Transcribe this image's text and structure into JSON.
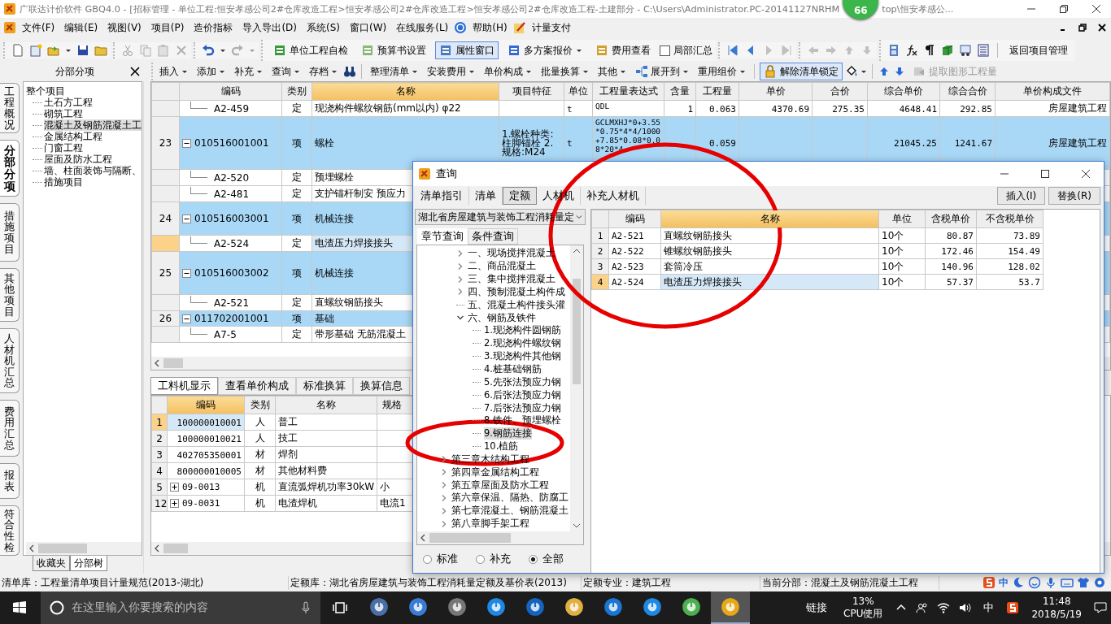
{
  "title_bar": {
    "title": "广联达计价软件 GBQ4.0 - [招标管理 - 单位工程:恒安孝感公司2#仓库改造工程>恒安孝感公司2#仓库改造工程>恒安孝感公司2#仓库改造工程-土建部分 - C:\\Users\\Administrator.PC-20141127NRHM",
    "title_tail": "top\\恒安孝感公..."
  },
  "floating_badge": "66",
  "menu": [
    "文件(F)",
    "编辑(E)",
    "视图(V)",
    "项目(P)",
    "造价指标",
    "导入导出(D)",
    "系统(S)",
    "窗口(W)",
    "在线服务(L)",
    "帮助(H)",
    "计量支付"
  ],
  "toolbar": {
    "buttons": [
      {
        "label": "单位工程自检",
        "pressed": false
      },
      {
        "label": "预算书设置",
        "pressed": false
      },
      {
        "label": "属性窗口",
        "pressed": true
      },
      {
        "label": "多方案报价",
        "pressed": false
      },
      {
        "label": "费用查看",
        "pressed": false
      }
    ],
    "checkbox": {
      "label": "局部汇总",
      "checked": false
    },
    "return_button": "返回项目管理"
  },
  "panel_header": "分部分项",
  "toolbar2": {
    "group1": [
      "插入",
      "添加",
      "补充",
      "查询",
      "存档"
    ],
    "group2": [
      "整理清单",
      "安装费用",
      "单价构成",
      "批量换算",
      "其他",
      "展开到",
      "重用组价"
    ],
    "unlock": {
      "label": "解除清单锁定",
      "pressed": true
    },
    "extract": {
      "label": "提取图形工程量",
      "disabled": true
    }
  },
  "side_tabs": [
    {
      "label": "工程概况",
      "selected": false
    },
    {
      "label": "分部分项",
      "selected": true
    },
    {
      "label": "措施项目",
      "selected": false
    },
    {
      "label": "其他项目",
      "selected": false
    },
    {
      "label": "人材机汇总",
      "selected": false
    },
    {
      "label": "费用汇总",
      "selected": false
    },
    {
      "label": "报表",
      "selected": false
    },
    {
      "label": "符合性检",
      "selected": false
    }
  ],
  "tree": {
    "label": "整个项目",
    "children": [
      {
        "label": "土石方工程",
        "selected": false
      },
      {
        "label": "砌筑工程",
        "selected": false
      },
      {
        "label": "混凝土及钢筋混凝土工",
        "selected": true
      },
      {
        "label": "金属结构工程",
        "selected": false
      },
      {
        "label": "门窗工程",
        "selected": false
      },
      {
        "label": "屋面及防水工程",
        "selected": false
      },
      {
        "label": "墙、柱面装饰与隔断、",
        "selected": false
      },
      {
        "label": "措施项目",
        "selected": false
      }
    ]
  },
  "tree_tabs": [
    {
      "label": "收藏夹",
      "selected": false
    },
    {
      "label": "分部树",
      "selected": true
    }
  ],
  "grid": {
    "columns": [
      {
        "label": "编码",
        "selected": false
      },
      {
        "label": "类别",
        "selected": false
      },
      {
        "label": "名称",
        "selected": true
      },
      {
        "label": "项目特征",
        "selected": false
      },
      {
        "label": "单位",
        "selected": false
      },
      {
        "label": "工程量表达式",
        "selected": false
      },
      {
        "label": "含量",
        "selected": false
      },
      {
        "label": "工程量",
        "selected": false
      },
      {
        "label": "单价",
        "selected": false
      },
      {
        "label": "合价",
        "selected": false
      },
      {
        "label": "综合单价",
        "selected": false
      },
      {
        "label": "综合合价",
        "selected": false
      },
      {
        "label": "单价构成文件",
        "selected": false
      }
    ],
    "rows": [
      {
        "kind": "sub",
        "code": "A2-459",
        "type": "定",
        "name": "现浇构件螺纹钢筋(mm以内) φ22",
        "unit": "t",
        "expr": "QDL",
        "content": "1",
        "qty": "0.063",
        "price": "4370.69",
        "total": "275.35",
        "comp_price": "4648.41",
        "comp_total": "292.85",
        "file": "房屋建筑工程",
        "selected": false
      },
      {
        "kind": "item",
        "no": "23",
        "expanded": true,
        "code": "010516001001",
        "type": "项",
        "name": "螺栓",
        "feature": "1.螺栓种类:柱脚锚栓 2.规格:M24",
        "unit": "t",
        "expr": "GCLMXHJ*0+3.55*0.75*4*4/1000+7.85*0.08*0.08*20*4",
        "qty": "0.059",
        "comp_price": "21045.25",
        "comp_total": "1241.67",
        "file": "房屋建筑工程",
        "selected": false
      },
      {
        "kind": "sub",
        "code": "A2-520",
        "type": "定",
        "name": "预埋螺栓",
        "selected": false
      },
      {
        "kind": "sub",
        "code": "A2-481",
        "type": "定",
        "name": "支护锚杆制安 预应力",
        "selected": false
      },
      {
        "kind": "item",
        "no": "24",
        "expanded": true,
        "code": "010516003001",
        "type": "项",
        "name": "机械连接",
        "selected": false
      },
      {
        "kind": "sub",
        "code": "A2-524",
        "type": "定",
        "name": "电渣压力焊接接头",
        "selected": true
      },
      {
        "kind": "item",
        "no": "25",
        "expanded": true,
        "code": "010516003002",
        "type": "项",
        "name": "机械连接",
        "selected": false
      },
      {
        "kind": "sub",
        "code": "A2-521",
        "type": "定",
        "name": "直螺纹钢筋接头",
        "selected": false
      },
      {
        "kind": "item",
        "no": "26",
        "expanded": true,
        "code": "011702001001",
        "type": "项",
        "name": "基础",
        "selected": false
      },
      {
        "kind": "sub",
        "code": "A7-5",
        "type": "定",
        "name": "带形基础 无筋混凝土",
        "selected": false
      }
    ]
  },
  "detail_tabs": [
    {
      "label": "工料机显示",
      "selected": true
    },
    {
      "label": "查看单价构成",
      "selected": false
    },
    {
      "label": "标准换算",
      "selected": false
    },
    {
      "label": "换算信息",
      "selected": false
    }
  ],
  "detail_grid": {
    "columns": [
      {
        "label": "编码",
        "selected": true
      },
      {
        "label": "类别",
        "selected": false
      },
      {
        "label": "名称",
        "selected": false
      },
      {
        "label": "规格",
        "selected": false
      }
    ],
    "rows": [
      {
        "no": "1",
        "kind": "plain",
        "code": "100000010001",
        "type": "人",
        "name": "普工",
        "selected": true
      },
      {
        "no": "2",
        "kind": "plain",
        "code": "100000010021",
        "type": "人",
        "name": "技工",
        "selected": false
      },
      {
        "no": "3",
        "kind": "plain",
        "code": "402705350001",
        "type": "材",
        "name": "焊剂",
        "selected": false
      },
      {
        "no": "4",
        "kind": "plain",
        "code": "800000010005",
        "type": "材",
        "name": "其他材料费",
        "selected": false
      },
      {
        "no": "5",
        "kind": "group",
        "expanded": false,
        "code": "09-0013",
        "type": "机",
        "name": "直流弧焊机功率30kW",
        "spec": "小",
        "selected": false
      },
      {
        "no": "12",
        "kind": "group",
        "expanded": false,
        "code": "09-0031",
        "type": "机",
        "name": "电渣焊机",
        "spec": "电流1",
        "selected": false
      }
    ]
  },
  "dialog": {
    "title": "查询",
    "tabs": [
      {
        "label": "清单指引",
        "selected": false
      },
      {
        "label": "清单",
        "selected": false
      },
      {
        "label": "定额",
        "selected": true
      },
      {
        "label": "人材机",
        "selected": false
      },
      {
        "label": "补充人材机",
        "selected": false
      }
    ],
    "buttons": [
      "插入(I)",
      "替换(R)"
    ],
    "library": "湖北省房屋建筑与装饰工程消耗量定",
    "search_tabs": [
      {
        "label": "章节查询",
        "selected": true
      },
      {
        "label": "条件查询",
        "selected": false
      }
    ],
    "tree": {
      "sections": [
        {
          "label": "一、现场搅拌混凝土",
          "kind": "branch",
          "expanded": false,
          "selected": false
        },
        {
          "label": "二、商品混凝土",
          "kind": "branch",
          "expanded": false,
          "selected": false
        },
        {
          "label": "三、集中搅拌混凝土",
          "kind": "branch",
          "expanded": false,
          "selected": false
        },
        {
          "label": "四、预制混凝土构件成",
          "kind": "branch",
          "expanded": false,
          "selected": false
        },
        {
          "label": "五、混凝土构件接头灌",
          "kind": "leaf",
          "selected": false
        },
        {
          "label": "六、钢筋及铁件",
          "kind": "branch",
          "expanded": true,
          "selected": false,
          "children": [
            {
              "label": "1.现浇构件圆钢筋",
              "selected": false
            },
            {
              "label": "2.现浇构件螺纹钢",
              "selected": false
            },
            {
              "label": "3.现浇构件其他钢",
              "selected": false
            },
            {
              "label": "4.桩基础钢筋",
              "selected": false
            },
            {
              "label": "5.先张法预应力钢",
              "selected": false
            },
            {
              "label": "6.后张法预应力钢",
              "selected": false
            },
            {
              "label": "7.后张法预应力钢",
              "selected": false
            },
            {
              "label": "8.铁件、预埋螺栓",
              "selected": false
            },
            {
              "label": "9.钢筋连接",
              "selected": true
            },
            {
              "label": "10.植筋",
              "selected": false
            }
          ]
        }
      ],
      "chapters": [
        {
          "label": "第三章木结构工程",
          "expanded": false
        },
        {
          "label": "第四章金属结构工程",
          "expanded": false
        },
        {
          "label": "第五章屋面及防水工程",
          "expanded": false
        },
        {
          "label": "第六章保温、隔热、防腐工",
          "expanded": false
        },
        {
          "label": "第七章混凝土、钢筋混凝土",
          "expanded": false
        },
        {
          "label": "第八章脚手架工程",
          "expanded": false
        }
      ]
    },
    "filters": [
      {
        "label": "标准",
        "selected": false
      },
      {
        "label": "补充",
        "selected": false
      },
      {
        "label": "全部",
        "selected": true
      }
    ],
    "columns": [
      {
        "label": "编码",
        "selected": false
      },
      {
        "label": "名称",
        "selected": true
      },
      {
        "label": "单位",
        "selected": false
      },
      {
        "label": "含税单价",
        "selected": false
      },
      {
        "label": "不含税单价",
        "selected": false
      }
    ],
    "rows": [
      {
        "no": "1",
        "code": "A2-521",
        "name": "直螺纹钢筋接头",
        "unit": "10个",
        "price_tax": "80.87",
        "price": "73.89",
        "selected": false
      },
      {
        "no": "2",
        "code": "A2-522",
        "name": "锥螺纹钢筋接头",
        "unit": "10个",
        "price_tax": "172.46",
        "price": "154.49",
        "selected": false
      },
      {
        "no": "3",
        "code": "A2-523",
        "name": "套筒冷压",
        "unit": "10个",
        "price_tax": "140.96",
        "price": "128.02",
        "selected": false
      },
      {
        "no": "4",
        "code": "A2-524",
        "name": "电渣压力焊接接头",
        "unit": "10个",
        "price_tax": "57.37",
        "price": "53.7",
        "selected": true
      }
    ]
  },
  "status_bar": [
    "清单库：工程量清单项目计量规范(2013-湖北)",
    "定额库：湖北省房屋建筑与装饰工程消耗量定额及基价表(2013)",
    "定额专业：建筑工程",
    "当前分部：混凝土及钢筋混凝土工程"
  ],
  "ime_mode": "中",
  "taskbar": {
    "search_placeholder": "在这里输入你要搜索的内容",
    "apps": [
      {
        "active": false
      },
      {
        "active": false
      },
      {
        "active": false
      },
      {
        "active": false
      },
      {
        "active": false
      },
      {
        "active": false
      },
      {
        "active": false
      },
      {
        "active": false
      },
      {
        "active": false
      },
      {
        "active": true
      }
    ],
    "links": "链接",
    "cpu_value": "13%",
    "cpu_label": "CPU使用",
    "input_mode": "中",
    "time": "11:48",
    "date": "2018/5/19"
  }
}
